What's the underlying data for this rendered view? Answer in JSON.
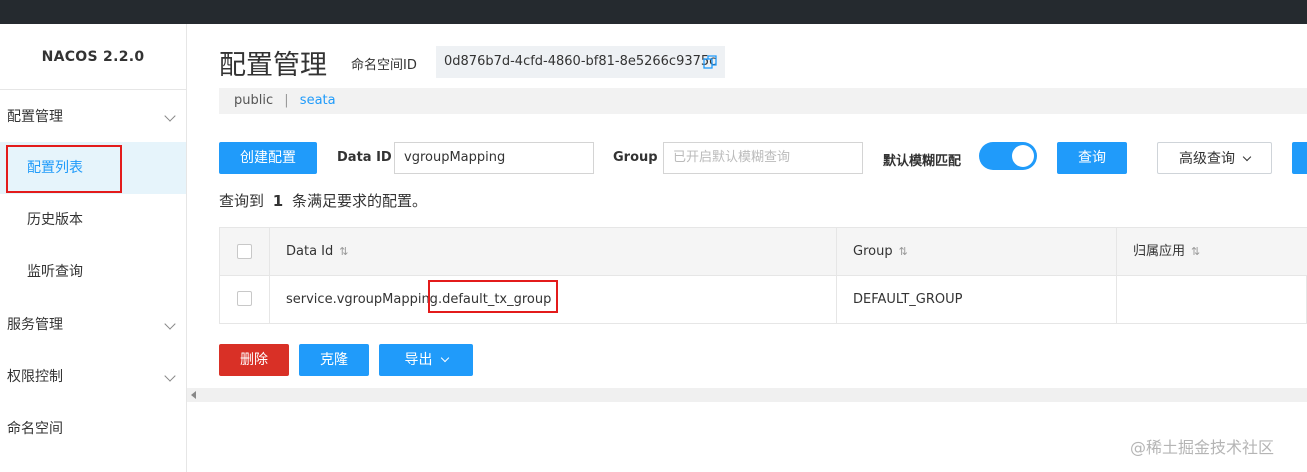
{
  "brand": "NACOS 2.2.0",
  "sidebar": {
    "groups": [
      {
        "label": "配置管理"
      },
      {
        "label": "服务管理"
      },
      {
        "label": "权限控制"
      },
      {
        "label": "命名空间"
      }
    ],
    "items": [
      {
        "label": "配置列表"
      },
      {
        "label": "历史版本"
      },
      {
        "label": "监听查询"
      }
    ]
  },
  "header": {
    "title": "配置管理",
    "namespace_label": "命名空间ID",
    "namespace_id": "0d876b7d-4cfd-4860-bf81-8e5266c9375c"
  },
  "breadcrumb": {
    "items": [
      "public",
      "seata"
    ]
  },
  "toolbar": {
    "create_label": "创建配置",
    "data_id_label": "Data ID",
    "data_id_value": "vgroupMapping",
    "group_label": "Group",
    "group_placeholder": "已开启默认模糊查询",
    "fuzzy_label": "默认模糊匹配",
    "fuzzy_on": true,
    "query_label": "查询",
    "advanced_label": "高级查询"
  },
  "result": {
    "prefix": "查询到",
    "count": "1",
    "suffix": "条满足要求的配置。"
  },
  "table": {
    "columns": [
      "Data Id",
      "Group",
      "归属应用"
    ],
    "rows": [
      {
        "data_id_part1": "service.vgroupMapping.",
        "data_id_part2": "default_tx_group",
        "group": "DEFAULT_GROUP",
        "app": ""
      }
    ]
  },
  "actions": {
    "delete_label": "删除",
    "clone_label": "克隆",
    "export_label": "导出"
  },
  "watermark": "@稀土掘金技术社区",
  "colors": {
    "primary": "#209bfa",
    "danger": "#d93026",
    "highlight_box": "#e31b1b",
    "topbar": "#252a2f"
  }
}
